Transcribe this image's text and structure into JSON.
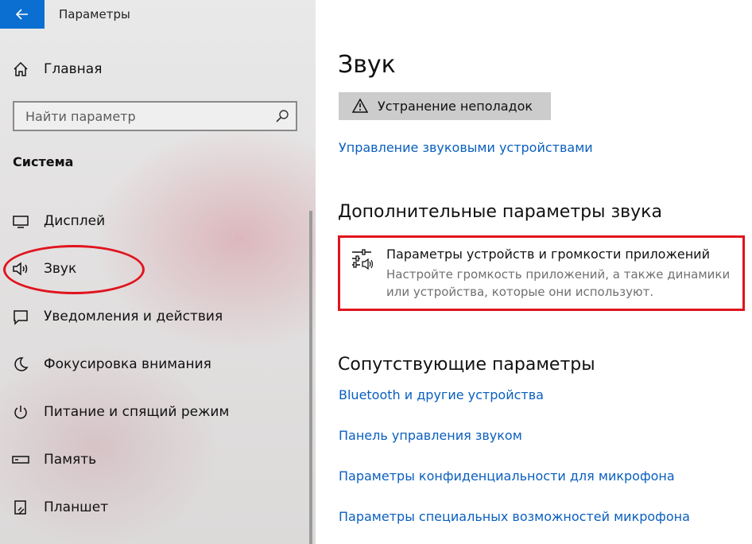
{
  "window": {
    "title": "Параметры",
    "back_icon": "arrow-left-icon",
    "accent_color": "#0a6fd0"
  },
  "sidebar": {
    "home": {
      "label": "Главная",
      "icon": "home-icon"
    },
    "search": {
      "placeholder": "Найти параметр",
      "icon": "search-icon"
    },
    "group_title": "Система",
    "items": [
      {
        "label": "Дисплей",
        "icon": "display-icon",
        "selected": false
      },
      {
        "label": "Звук",
        "icon": "speaker-icon",
        "selected": true
      },
      {
        "label": "Уведомления и действия",
        "icon": "notification-icon",
        "selected": false
      },
      {
        "label": "Фокусировка внимания",
        "icon": "moon-icon",
        "selected": false
      },
      {
        "label": "Питание и спящий режим",
        "icon": "power-icon",
        "selected": false
      },
      {
        "label": "Память",
        "icon": "storage-icon",
        "selected": false
      },
      {
        "label": "Планшет",
        "icon": "tablet-icon",
        "selected": false
      }
    ]
  },
  "main": {
    "title": "Звук",
    "troubleshoot": {
      "label": "Устранение неполадок",
      "icon": "warning-icon"
    },
    "manage_devices_link": "Управление звуковыми устройствами",
    "advanced": {
      "heading": "Дополнительные параметры звука",
      "app_volume": {
        "title": "Параметры устройств и громкости приложений",
        "description": "Настройте громкость приложений, а также динамики или устройства, которые они используют.",
        "icon": "mixer-icon"
      }
    },
    "related": {
      "heading": "Сопутствующие параметры",
      "links": [
        "Bluetooth и другие устройства",
        "Панель управления звуком",
        "Параметры конфиденциальности для микрофона",
        "Параметры специальных возможностей микрофона"
      ]
    },
    "link_color": "#0a5fbf"
  },
  "annotations": {
    "highlight_color": "#e0141e"
  }
}
